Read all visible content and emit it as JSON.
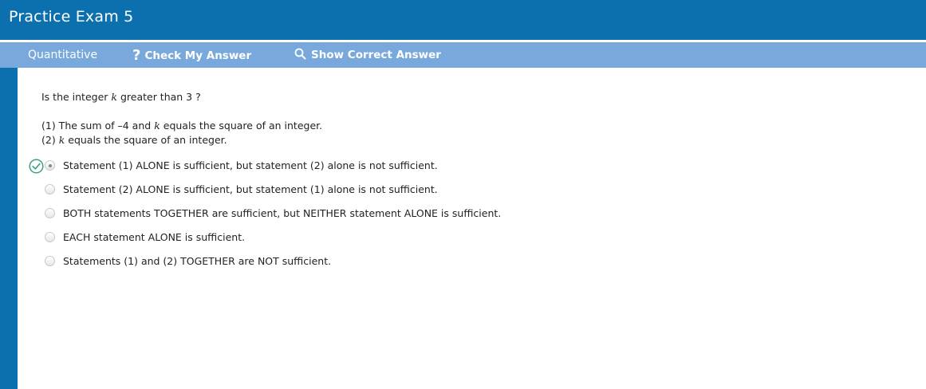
{
  "header": {
    "title": "Practice Exam 5"
  },
  "toolbar": {
    "section_label": "Quantitative",
    "check_answer_label": "Check My Answer",
    "show_answer_label": "Show Correct Answer",
    "check_icon": "question-mark-icon",
    "show_icon": "magnifier-icon"
  },
  "question": {
    "stem_before": "Is the integer ",
    "variable": "k",
    "stem_after": "greater than 3 ?",
    "statement1_before": "(1) The sum of –4 and ",
    "statement1_var": "k",
    "statement1_after": "equals the square of an integer.",
    "statement2_before": "(2) ",
    "statement2_var": "k",
    "statement2_after": "equals the square of an integer."
  },
  "choices": [
    {
      "label": "Statement (1) ALONE is sufficient, but statement (2) alone is not sufficient.",
      "selected": true,
      "correct": true
    },
    {
      "label": "Statement (2) ALONE is sufficient, but statement (1) alone is not sufficient.",
      "selected": false
    },
    {
      "label": "BOTH statements TOGETHER are sufficient, but NEITHER statement ALONE is sufficient.",
      "selected": false
    },
    {
      "label": "EACH statement ALONE is sufficient.",
      "selected": false
    },
    {
      "label": "Statements (1) and (2) TOGETHER are NOT sufficient.",
      "selected": false
    }
  ],
  "colors": {
    "header_bg": "#0c6fae",
    "toolbar_bg": "#78a8dc",
    "correct_mark": "#3aa57a"
  }
}
